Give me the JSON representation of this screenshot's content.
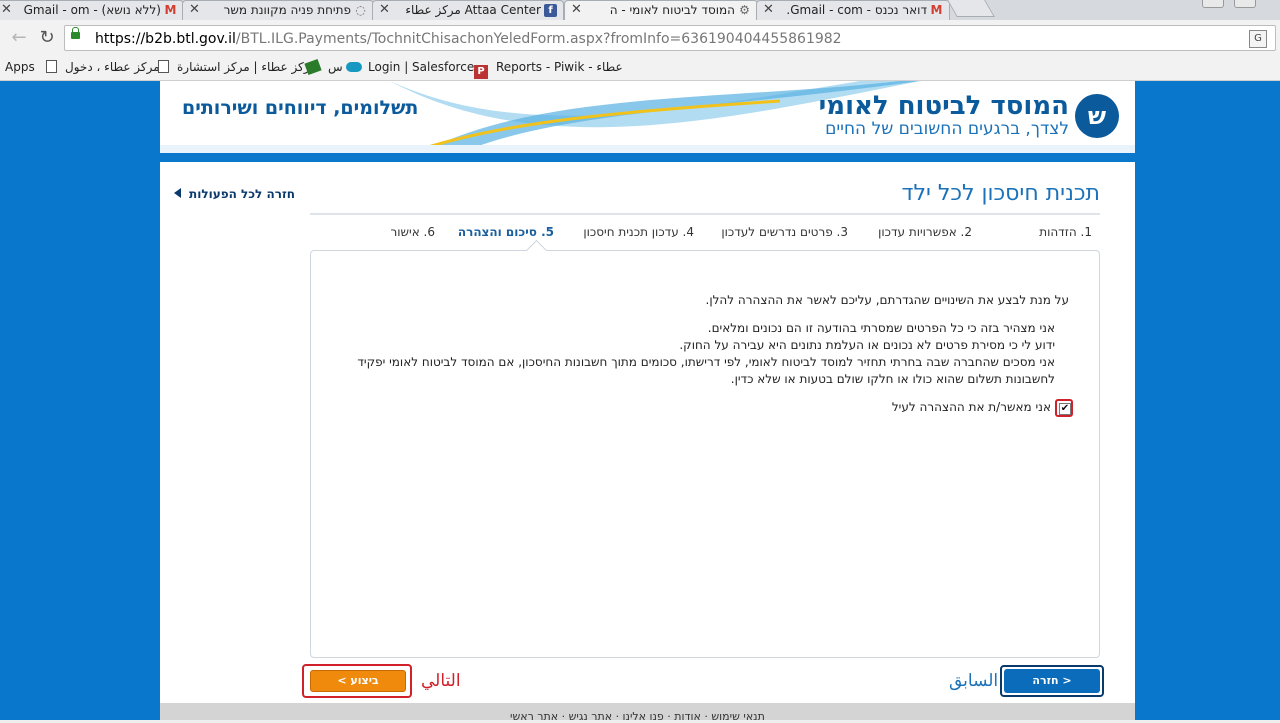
{
  "browser": {
    "tabs": [
      {
        "title": "(ללא נושא) - Gmail - om",
        "icon": "gmail-icon"
      },
      {
        "title": "פתיחת פניה מקוונת משר",
        "icon": "page-icon"
      },
      {
        "title": "Attaa Center مركز عطاء",
        "icon": "facebook-icon"
      },
      {
        "title": "המוסד לביטוח לאומי - ה",
        "icon": "gear-icon"
      },
      {
        "title": "דואר נכנס - Gmail - com.",
        "icon": "gmail-icon"
      }
    ],
    "close_glyph": "✕",
    "url_host": "https://b2b.btl.gov.il",
    "url_rest": "/BTL.ILG.Payments/TochnitChisachonYeledForm.aspx?fromInfo=636190404455861982",
    "bookmarks": {
      "apps": "Apps",
      "b1": "مركز عطاء ، دخول",
      "b2": "مركز عطاء | مركز استشارة",
      "b3": "س",
      "b4": "Login | Salesforce",
      "b5": "Reports - Piwik - عطاء"
    }
  },
  "banner": {
    "org_name": "המוסד לביטוח לאומי",
    "org_slogan": "לצדך, ברגעים החשובים של החיים",
    "section_title": "תשלומים, דיווחים ושירותים",
    "colors": {
      "primary": "#0a5a9c",
      "accent": "#1c72b8",
      "page_bg": "#0877cc"
    }
  },
  "form": {
    "title": "תכנית חיסכון לכל ילד",
    "back_link": "חזרה לכל הפעולות",
    "steps": [
      {
        "label": "1. הזדהות"
      },
      {
        "label": "2. אפשרויות עדכון"
      },
      {
        "label": "3. פרטים נדרשים לעדכון"
      },
      {
        "label": "4. עדכון תכנית חיסכון"
      },
      {
        "label": "5. סיכום והצהרה",
        "current": true
      },
      {
        "label": "6. אישור"
      }
    ],
    "intro": "על מנת לבצע את השינויים שהגדרתם, עליכם לאשר את ההצהרה להלן.",
    "declaration_lines": [
      "אני מצהיר בזה כי כל הפרטים שמסרתי בהודעה זו הם נכונים ומלאים.",
      "ידוע לי כי מסירת פרטים לא נכונים או העלמת נתונים היא עבירה על החוק.",
      "אני מסכים שהחברה שבה בחרתי תחזיר למוסד לביטוח לאומי, לפי דרישתו, סכומים מתוך חשבונות החיסכון, אם המוסד לביטוח לאומי יפקיד",
      "לחשבונות תשלום שהוא כולו או חלקו שולם בטעות או שלא כדין."
    ],
    "agree_label": "אני מאשר/ת את ההצהרה לעיל",
    "agree_checked": true,
    "agree_mark": "✔",
    "prev_button": "< חזרה",
    "prev_annotation": "السابق",
    "next_button": "ביצוע >",
    "next_annotation": "التالي"
  },
  "footer": {
    "links": "תנאי שימוש · אודות · פנו אלינו · אתר נגיש · אתר ראשי"
  }
}
